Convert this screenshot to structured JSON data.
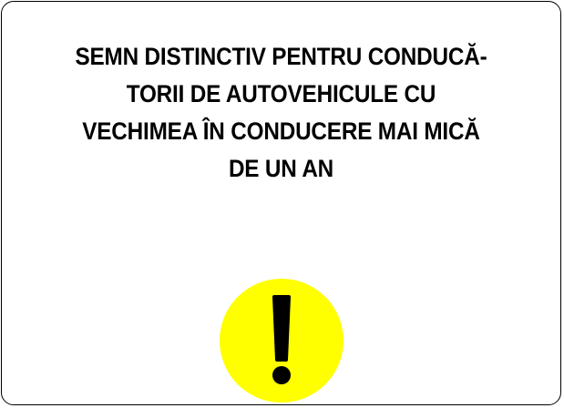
{
  "sign": {
    "lines": [
      "SEMN DISTINCTIV PENTRU CONDUCĂ-",
      "TORII DE AUTOVEHICULE CU",
      "VECHIMEA ÎN CONDUCERE MAI MICĂ",
      "DE UN AN"
    ],
    "symbol": "exclamation-mark-icon",
    "colors": {
      "background": "#ffffff",
      "border": "#000000",
      "text": "#000000",
      "circle": "#ffff00",
      "symbol": "#000000"
    }
  }
}
